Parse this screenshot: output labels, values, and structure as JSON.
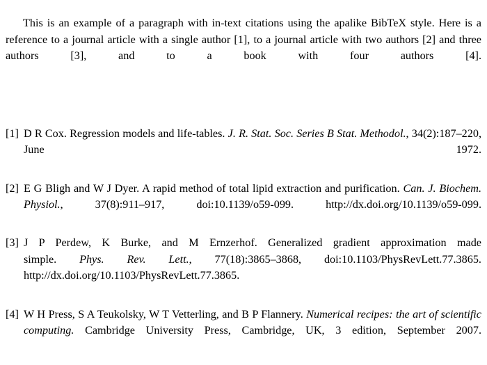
{
  "document": {
    "intro": {
      "text_before_bibtex": "This is an example of a paragraph with in-text citations using the apalike ",
      "bibtex_word": "BibTeX",
      "text_after_bibtex": " style. Here is a reference to a journal article with a single author [1], to a journal article with two authors [2] and three authors [3], and to a book with four authors [4]."
    },
    "bibliography": [
      {
        "label": "[1]",
        "authors": "D R Cox.",
        "title": "Regression models and life-tables.",
        "journal": "J. R. Stat. Soc. Series B Stat. Methodol.",
        "volume_issue_pages": "34(2):187–220,",
        "date": "June 1972.",
        "full_text": "D R Cox. Regression models and life-tables. J. R. Stat. Soc. Series B Stat. Methodol., 34(2):187–220, June 1972."
      },
      {
        "label": "[2]",
        "authors": "E G Bligh and W J Dyer.",
        "title": "A rapid method of total lipid extraction and purification.",
        "journal": "Can. J. Biochem. Physiol.",
        "volume_issue_pages": "37(8):911–917,",
        "doi": "doi:10.1139/o59-099.",
        "url": "http://dx.doi.org/10.1139/o59-099.",
        "full_text": "E G Bligh and W J Dyer. A rapid method of total lipid extraction and purification. Can. J. Biochem. Physiol., 37(8):911–917, doi:10.1139/o59-099. http://dx.doi.org/10.1139/o59-099."
      },
      {
        "label": "[3]",
        "authors": "J P Perdew, K Burke, and M Ernzerhof.",
        "title": "Generalized gradient approximation made simple.",
        "journal": "Phys. Rev. Lett.",
        "volume_issue_pages": "77(18):3865–3868,",
        "doi": "doi:10.1103/PhysRevLett.77.3865.",
        "url": "http://dx.doi.org/10.1103/PhysRevLett.77.3865.",
        "full_text": "J P Perdew, K Burke, and M Ernzerhof. Generalized gradient approximation made simple. Phys. Rev. Lett., 77(18):3865–3868, doi:10.1103/PhysRevLett.77.3865. http://dx.doi.org/10.1103/PhysRevLett.77.3865."
      },
      {
        "label": "[4]",
        "authors": "W H Press, S A Teukolsky, W T Vetterling, and B P Flannery.",
        "title": "Numerical recipes: the art of scientific computing.",
        "publisher": "Cambridge University Press,",
        "place_edition_date": "Cambridge, UK, 3 edition, September 2007.",
        "full_text": "W H Press, S A Teukolsky, W T Vetterling, and B P Flannery. Numerical recipes: the art of scientific computing. Cambridge University Press, Cambridge, UK, 3 edition, September 2007."
      }
    ]
  }
}
